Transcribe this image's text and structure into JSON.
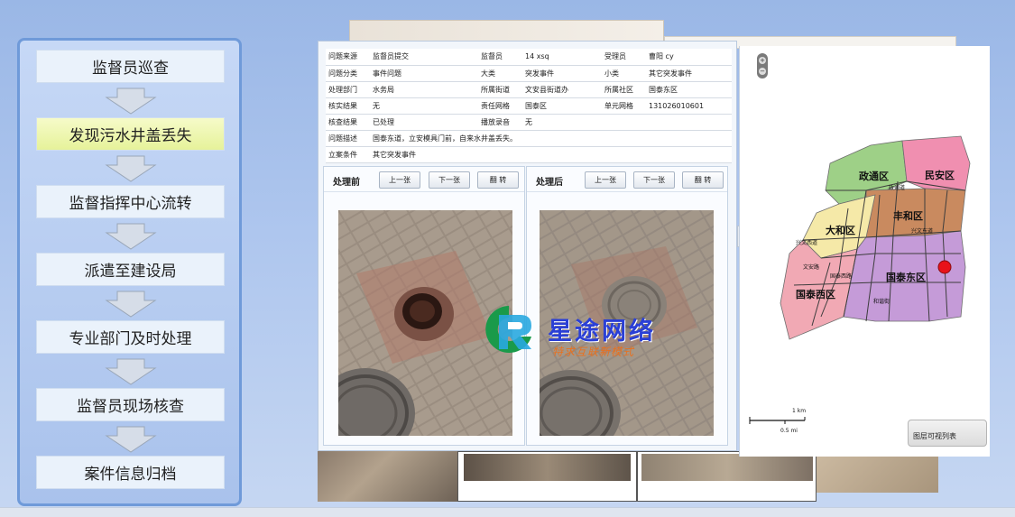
{
  "flow": {
    "steps": [
      {
        "label": "监督员巡查"
      },
      {
        "label": "发现污水井盖丢失"
      },
      {
        "label": "监督指挥中心流转"
      },
      {
        "label": "派遣至建设局"
      },
      {
        "label": "专业部门及时处理"
      },
      {
        "label": "监督员现场核查"
      },
      {
        "label": "案件信息归档"
      }
    ],
    "active_index": 1
  },
  "case_info": {
    "row1": {
      "k1": "问题来源",
      "v1": "监督员提交",
      "k2": "监督员",
      "v2": "14 xsq",
      "k3": "受理员",
      "v3": "曹阳 cy"
    },
    "row2": {
      "k1": "问题分类",
      "v1": "事件问题",
      "k2": "大类",
      "v2": "突发事件",
      "k3": "小类",
      "v3": "其它突发事件"
    },
    "row3": {
      "k1": "处理部门",
      "v1": "水务局",
      "k2": "所属街道",
      "v2": "文安县街道办",
      "k3": "所属社区",
      "v3": "国泰东区"
    },
    "row4": {
      "k1": "核实结果",
      "v1": "无",
      "k2": "责任网格",
      "v2": "国泰区",
      "k3": "单元网格",
      "v3": "131026010601"
    },
    "row5": {
      "k1": "核查结果",
      "v1": "已处理",
      "k2": "播放录音",
      "v2": "无"
    },
    "row6": {
      "k1": "问题描述",
      "v1": "国泰东道，立安模具门前，自来水井盖丢失。"
    },
    "row7": {
      "k1": "立案条件",
      "v1": "其它突发事件"
    }
  },
  "photo_before": {
    "title": "处理前",
    "prev": "上一张",
    "next": "下一张",
    "rotate": "翻 转"
  },
  "photo_after": {
    "title": "处理后",
    "prev": "上一张",
    "next": "下一张",
    "rotate": "翻 转"
  },
  "map": {
    "districts": [
      "政通区",
      "民安区",
      "丰和区",
      "大和区",
      "国泰东区",
      "国泰西区"
    ],
    "roads": [
      "政通道",
      "兴文东道",
      "兴文西道",
      "文安路",
      "国泰西路",
      "和谐街"
    ],
    "scale_km": "1 km",
    "scale_mi": "0.5 mi",
    "layer_button": "图层可视列表",
    "marker_color": "#e8121a"
  },
  "watermark": {
    "title": "星途网络",
    "subtitle": "特求互联新模式"
  },
  "colors": {
    "panel_border": "#6f9ad9",
    "active_step": "#e6f29a",
    "watermark_title": "#2a3fd6",
    "watermark_sub": "#e8711f"
  }
}
